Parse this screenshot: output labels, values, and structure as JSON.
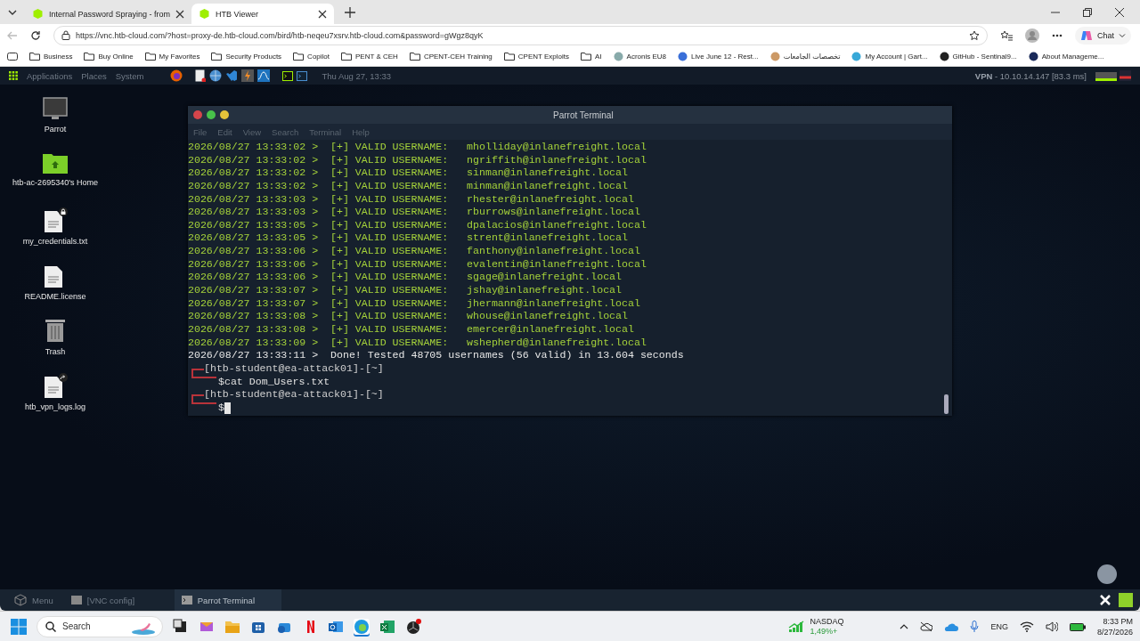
{
  "browser": {
    "tabs": [
      {
        "title": "Internal Password Spraying - from",
        "selected": false
      },
      {
        "title": "HTB Viewer",
        "selected": true
      }
    ],
    "url": "https://vnc.htb-cloud.com/?host=proxy-de.htb-cloud.com/bird/htb-neqeu7xsrv.htb-cloud.com&password=gWgz8qyK",
    "chat_label": "Chat",
    "bookmarks": [
      "Business",
      "Buy Online",
      "My Favorites",
      "Security Products",
      "Copilot",
      "PENT & CEH",
      "CPENT-CEH Training",
      "CPENT Exploits",
      "AI",
      "Acronis EU8",
      "Live June 12 - Rest...",
      "تخصصات الجامعات",
      "My Account | Gart...",
      "GitHub - Sentinal9...",
      "About Manageme..."
    ]
  },
  "top_panel": {
    "menus": [
      "Applications",
      "Places",
      "System"
    ],
    "clock": "Thu Aug 27, 13:33",
    "vpn_label": "VPN",
    "vpn_info": " - 10.10.14.147 [83.3 ms]"
  },
  "desktop_icons": [
    {
      "kind": "monitor",
      "label": "Parrot"
    },
    {
      "kind": "home",
      "label": "htb-ac-2695340's Home"
    },
    {
      "kind": "locked-file",
      "label": "my_credentials.txt"
    },
    {
      "kind": "file",
      "label": "README.license"
    },
    {
      "kind": "trash",
      "label": "Trash"
    },
    {
      "kind": "linked-file",
      "label": "htb_vpn_logs.log"
    }
  ],
  "terminal": {
    "title": "Parrot Terminal",
    "menu": [
      "File",
      "Edit",
      "View",
      "Search",
      "Terminal",
      "Help"
    ],
    "lines": [
      {
        "kind": "valid",
        "text": "2026/08/27 13:33:02 >  [+] VALID USERNAME:\t mholliday@inlanefreight.local"
      },
      {
        "kind": "valid",
        "text": "2026/08/27 13:33:02 >  [+] VALID USERNAME:\t ngriffith@inlanefreight.local"
      },
      {
        "kind": "valid",
        "text": "2026/08/27 13:33:02 >  [+] VALID USERNAME:\t sinman@inlanefreight.local"
      },
      {
        "kind": "valid",
        "text": "2026/08/27 13:33:02 >  [+] VALID USERNAME:\t minman@inlanefreight.local"
      },
      {
        "kind": "valid",
        "text": "2026/08/27 13:33:03 >  [+] VALID USERNAME:\t rhester@inlanefreight.local"
      },
      {
        "kind": "valid",
        "text": "2026/08/27 13:33:03 >  [+] VALID USERNAME:\t rburrows@inlanefreight.local"
      },
      {
        "kind": "valid",
        "text": "2026/08/27 13:33:05 >  [+] VALID USERNAME:\t dpalacios@inlanefreight.local"
      },
      {
        "kind": "valid",
        "text": "2026/08/27 13:33:05 >  [+] VALID USERNAME:\t strent@inlanefreight.local"
      },
      {
        "kind": "valid",
        "text": "2026/08/27 13:33:06 >  [+] VALID USERNAME:\t fanthony@inlanefreight.local"
      },
      {
        "kind": "valid",
        "text": "2026/08/27 13:33:06 >  [+] VALID USERNAME:\t evalentin@inlanefreight.local"
      },
      {
        "kind": "valid",
        "text": "2026/08/27 13:33:06 >  [+] VALID USERNAME:\t sgage@inlanefreight.local"
      },
      {
        "kind": "valid",
        "text": "2026/08/27 13:33:07 >  [+] VALID USERNAME:\t jshay@inlanefreight.local"
      },
      {
        "kind": "valid",
        "text": "2026/08/27 13:33:07 >  [+] VALID USERNAME:\t jhermann@inlanefreight.local"
      },
      {
        "kind": "valid",
        "text": "2026/08/27 13:33:08 >  [+] VALID USERNAME:\t whouse@inlanefreight.local"
      },
      {
        "kind": "valid",
        "text": "2026/08/27 13:33:08 >  [+] VALID USERNAME:\t emercer@inlanefreight.local"
      },
      {
        "kind": "valid",
        "text": "2026/08/27 13:33:09 >  [+] VALID USERNAME:\t wshepherd@inlanefreight.local"
      },
      {
        "kind": "plain",
        "text": "2026/08/27 13:33:11 >  Done! Tested 48705 usernames (56 valid) in 13.604 seconds"
      },
      {
        "kind": "prompt",
        "text": "[htb-student@ea-attack01]-[~]"
      },
      {
        "kind": "command",
        "text": "$cat Dom_Users.txt"
      },
      {
        "kind": "prompt",
        "text": "[htb-student@ea-attack01]-[~]"
      },
      {
        "kind": "input",
        "text": "$"
      }
    ]
  },
  "bottom_panel": {
    "menu_label": "Menu",
    "tasks": [
      {
        "title": "[VNC config]",
        "selected": false
      },
      {
        "title": "Parrot Terminal",
        "selected": true
      }
    ]
  },
  "taskbar": {
    "search_placeholder": "Search",
    "stock_name": "NASDAQ",
    "stock_change": "1,49%+",
    "language": "ENG",
    "time": "8:33 PM",
    "date": "8/27/2026"
  }
}
